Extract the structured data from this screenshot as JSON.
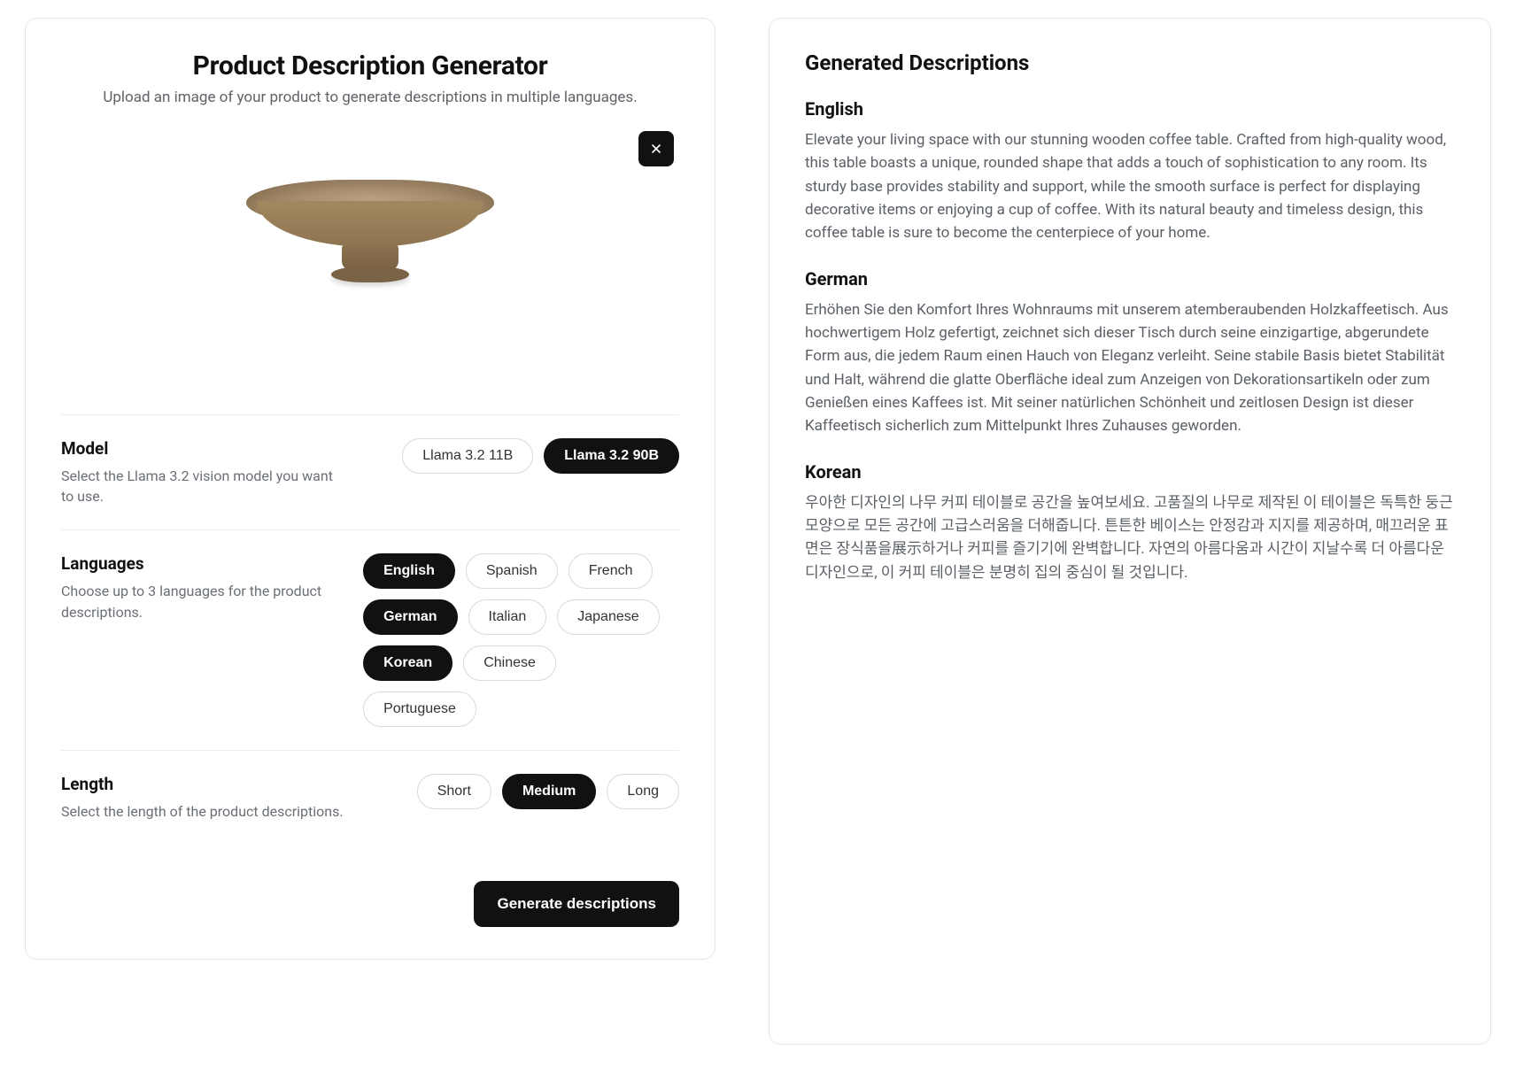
{
  "generator": {
    "title": "Product Description Generator",
    "subtitle": "Upload an image of your product to generate descriptions in multiple languages.",
    "image_alt": "wooden-bowl-product-image"
  },
  "model": {
    "section_title": "Model",
    "section_desc": "Select the Llama 3.2 vision model you want to use.",
    "options": [
      {
        "label": "Llama 3.2 11B",
        "selected": false
      },
      {
        "label": "Llama 3.2 90B",
        "selected": true
      }
    ]
  },
  "languages": {
    "section_title": "Languages",
    "section_desc": "Choose up to 3 languages for the product descriptions.",
    "options": [
      {
        "label": "English",
        "selected": true
      },
      {
        "label": "Spanish",
        "selected": false
      },
      {
        "label": "French",
        "selected": false
      },
      {
        "label": "German",
        "selected": true
      },
      {
        "label": "Italian",
        "selected": false
      },
      {
        "label": "Japanese",
        "selected": false
      },
      {
        "label": "Korean",
        "selected": true
      },
      {
        "label": "Chinese",
        "selected": false
      },
      {
        "label": "Portuguese",
        "selected": false
      }
    ]
  },
  "length": {
    "section_title": "Length",
    "section_desc": "Select the length of the product descriptions.",
    "options": [
      {
        "label": "Short",
        "selected": false
      },
      {
        "label": "Medium",
        "selected": true
      },
      {
        "label": "Long",
        "selected": false
      }
    ]
  },
  "actions": {
    "generate_label": "Generate descriptions"
  },
  "output": {
    "title": "Generated Descriptions",
    "items": [
      {
        "language": "English",
        "text": "Elevate your living space with our stunning wooden coffee table. Crafted from high-quality wood, this table boasts a unique, rounded shape that adds a touch of sophistication to any room. Its sturdy base provides stability and support, while the smooth surface is perfect for displaying decorative items or enjoying a cup of coffee. With its natural beauty and timeless design, this coffee table is sure to become the centerpiece of your home."
      },
      {
        "language": "German",
        "text": "Erhöhen Sie den Komfort Ihres Wohnraums mit unserem atemberaubenden Holzkaffeetisch. Aus hochwertigem Holz gefertigt, zeichnet sich dieser Tisch durch seine einzigartige, abgerundete Form aus, die jedem Raum einen Hauch von Eleganz verleiht. Seine stabile Basis bietet Stabilität und Halt, während die glatte Oberfläche ideal zum Anzeigen von Dekorationsartikeln oder zum Genießen eines Kaffees ist. Mit seiner natürlichen Schönheit und zeitlosen Design ist dieser Kaffeetisch sicherlich zum Mittelpunkt Ihres Zuhauses geworden."
      },
      {
        "language": "Korean",
        "text": "우아한 디자인의 나무 커피 테이블로 공간을 높여보세요. 고품질의 나무로 제작된 이 테이블은 독특한 둥근 모양으로 모든 공간에 고급스러움을 더해줍니다. 튼튼한 베이스는 안정감과 지지를 제공하며, 매끄러운 표면은 장식품을展示하거나 커피를 즐기기에 완벽합니다. 자연의 아름다움과 시간이 지날수록 더 아름다운 디자인으로, 이 커피 테이블은 분명히 집의 중심이 될 것입니다."
      }
    ]
  }
}
